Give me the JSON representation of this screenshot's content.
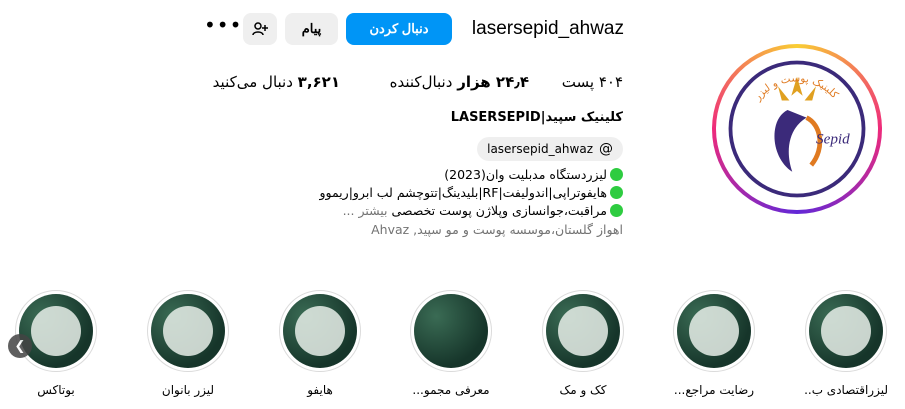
{
  "profile": {
    "username": "lasersepid_ahwaz",
    "follow_label": "دنبال کردن",
    "message_label": "پیام",
    "more_label": "•••",
    "full_name": "کلینیک سپید|LASERSEPID",
    "threads_handle": "lasersepid_ahwaz",
    "threads_icon": "threads-icon",
    "suggest_icon": "add-person-icon",
    "avatar_text": "کلینیک پوست و لیزر",
    "avatar_logo_text": "Sepid"
  },
  "stats": {
    "posts": "۴۰۴ پست",
    "followers_num": "۲۴٫۴ هزار",
    "followers_label": " دنبال‌کننده",
    "following_num": "۳,۶۲۱",
    "following_label": " دنبال می‌کنید"
  },
  "bio": {
    "line1": "لیزردستگاه مدبلیت وان(2023)",
    "line2": "هایفوتراپی|اندولیفت|RF|بلیدینگ|تتوچشم لب ابرو|ریموو",
    "line3": "مراقبت،جوانسازی وپلاژن پوست تخصصی",
    "more": "بیشتر ...",
    "location": "اهواز گلستان،موسسه پوست و مو سپید, Ahvaz"
  },
  "highlights": [
    {
      "label": "لیزراقتصادی ب..."
    },
    {
      "label": "رضایت مراجع..."
    },
    {
      "label": "کک و مک"
    },
    {
      "label": "معرفی مجمو..."
    },
    {
      "label": "هایفو"
    },
    {
      "label": "لیزر بانوان"
    },
    {
      "label": "بوتاکس"
    }
  ],
  "colors": {
    "accent": "#0095f6",
    "bio_dot": "#2ecc40",
    "button_bg": "#efefef"
  },
  "nav": {
    "prev_icon": "chevron-left-icon"
  }
}
